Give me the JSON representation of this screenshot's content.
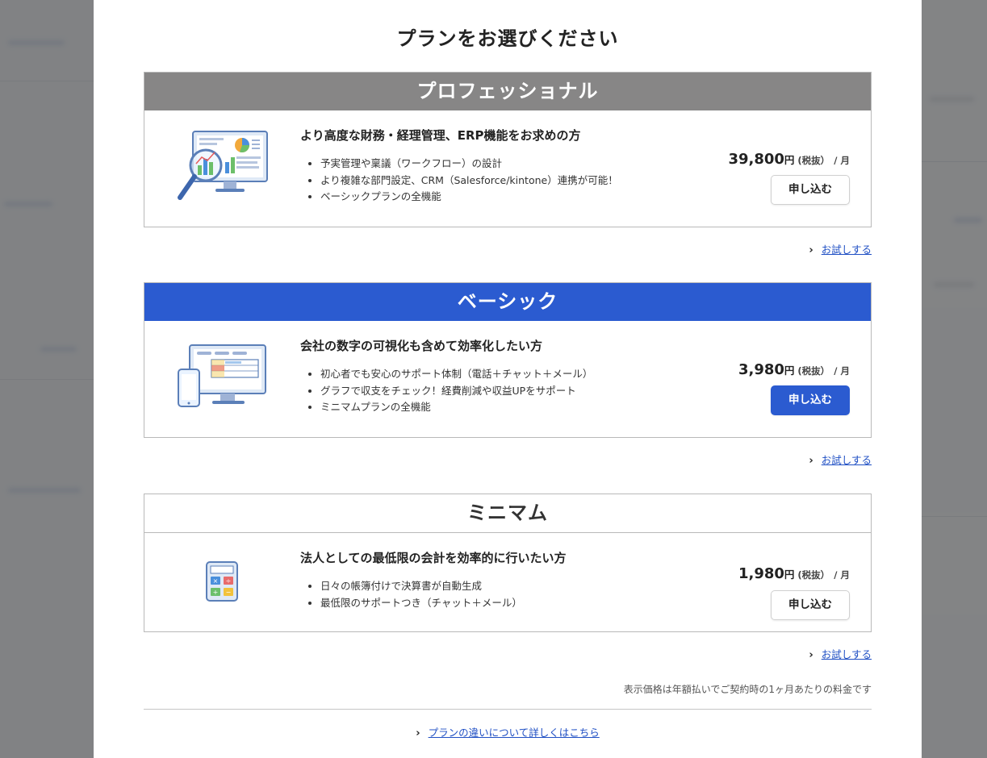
{
  "modal": {
    "title": "プランをお選びください",
    "plans": [
      {
        "name": "プロフェッショナル",
        "heading": "より高度な財務・経理管理、ERP機能をお求めの方",
        "features": [
          "予実管理や稟議（ワークフロー）の設計",
          "より複雑な部門設定、CRM（Salesforce/kintone）連携が可能！",
          "ベーシックプランの全機能"
        ],
        "price_amount": "39,800",
        "price_unit": "円",
        "price_tax": "(税抜）",
        "price_month": "/ 月",
        "apply_label": "申し込む",
        "trial_label": "お試しする",
        "illustration": "monitor-magnifier-illustration",
        "header_color": "#878686"
      },
      {
        "name": "ベーシック",
        "heading": "会社の数字の可視化も含めて効率化したい方",
        "features": [
          "初心者でも安心のサポート体制（電話＋チャット＋メール）",
          "グラフで収支をチェック！経費削減や収益UPをサポート",
          "ミニマムプランの全機能"
        ],
        "price_amount": "3,980",
        "price_unit": "円",
        "price_tax": "(税抜）",
        "price_month": "/ 月",
        "apply_label": "申し込む",
        "trial_label": "お試しする",
        "illustration": "monitor-phone-illustration",
        "header_color": "#2b5bd0"
      },
      {
        "name": "ミニマム",
        "heading": "法人としての最低限の会計を効率的に行いたい方",
        "features": [
          "日々の帳簿付けで決算書が自動生成",
          "最低限のサポートつき（チャット＋メール）"
        ],
        "price_amount": "1,980",
        "price_unit": "円",
        "price_tax": "(税抜）",
        "price_month": "/ 月",
        "apply_label": "申し込む",
        "trial_label": "お試しする",
        "illustration": "calculator-illustration",
        "header_color": "#ffffff"
      }
    ],
    "price_note": "表示価格は年額払いでご契約時の1ヶ月あたりの料金です",
    "detail_link": "プランの違いについて詳しくはこちら",
    "chevron_icon": "chevron-right-icon"
  }
}
